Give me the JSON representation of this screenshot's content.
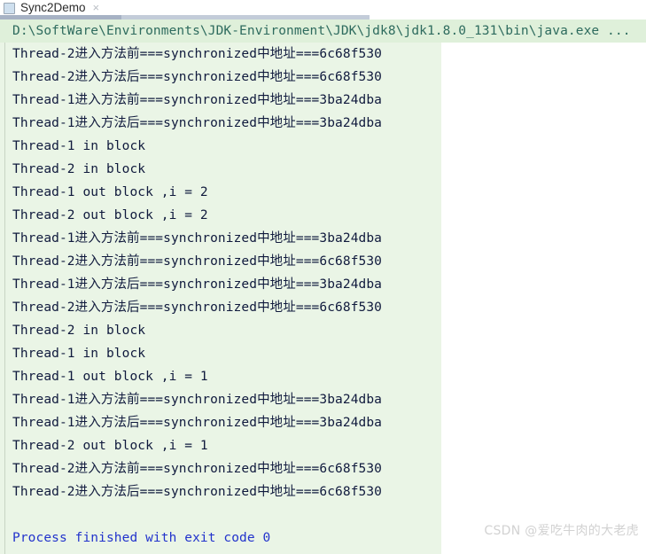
{
  "tab": {
    "label": "Sync2Demo",
    "close_label": "×",
    "icon": "run-configuration-icon"
  },
  "console": {
    "command_line": "D:\\SoftWare\\Environments\\JDK-Environment\\JDK\\jdk8\\jdk1.8.0_131\\bin\\java.exe ...",
    "lines": [
      "Thread-2进入方法前===synchronized中地址===6c68f530",
      "Thread-2进入方法后===synchronized中地址===6c68f530",
      "Thread-1进入方法前===synchronized中地址===3ba24dba",
      "Thread-1进入方法后===synchronized中地址===3ba24dba",
      "Thread-1 in block",
      "Thread-2 in block",
      "Thread-1 out block ,i = 2",
      "Thread-2 out block ,i = 2",
      "Thread-1进入方法前===synchronized中地址===3ba24dba",
      "Thread-2进入方法前===synchronized中地址===6c68f530",
      "Thread-1进入方法后===synchronized中地址===3ba24dba",
      "Thread-2进入方法后===synchronized中地址===6c68f530",
      "Thread-2 in block",
      "Thread-1 in block",
      "Thread-1 out block ,i = 1",
      "Thread-1进入方法前===synchronized中地址===3ba24dba",
      "Thread-1进入方法后===synchronized中地址===3ba24dba",
      "Thread-2 out block ,i = 1",
      "Thread-2进入方法前===synchronized中地址===6c68f530",
      "Thread-2进入方法后===synchronized中地址===6c68f530",
      ""
    ],
    "exit_line": "Process finished with exit code 0"
  },
  "watermark": {
    "text": "CSDN @爱吃牛肉的大老虎"
  },
  "colors": {
    "console_background": "#eaf5e6",
    "command_background": "#dff0da",
    "command_text": "#2e6b5e",
    "output_text": "#101a3d",
    "exit_text": "#2233cc",
    "tab_underline": "#a7b2c4",
    "watermark_text": "#d2d2d2"
  }
}
